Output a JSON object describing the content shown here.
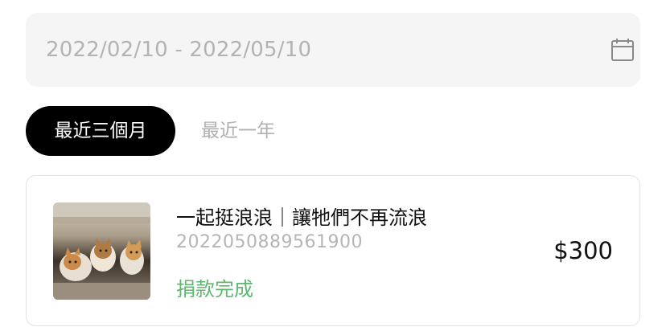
{
  "date_filter": {
    "range_text": "2022/02/10 - 2022/05/10",
    "icon": "calendar-icon"
  },
  "tabs": [
    {
      "label": "最近三個月",
      "active": true
    },
    {
      "label": "最近一年",
      "active": false
    }
  ],
  "donations": [
    {
      "title": "一起挺浪浪｜讓牠們不再流浪",
      "order_id": "2022050889561900",
      "status": "捐款完成",
      "amount": "$300",
      "status_color": "#5bb86d",
      "image": "kittens-photo"
    }
  ],
  "colors": {
    "active_tab_bg": "#000000",
    "field_bg": "#f5f5f5",
    "success": "#5bb86d"
  }
}
